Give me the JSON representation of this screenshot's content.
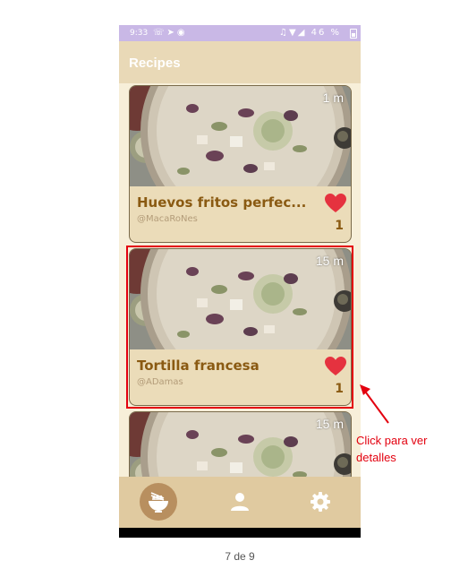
{
  "statusbar": {
    "time": "9:33",
    "left_icons": [
      "whatsapp-icon",
      "telegram-icon",
      "app-icon"
    ],
    "right_icons": [
      "mute-icon",
      "wifi-icon",
      "signal-icon"
    ],
    "battery": "46 %"
  },
  "appbar": {
    "title": "Recipes"
  },
  "recipes": [
    {
      "duration": "1 m",
      "name": "Huevos fritos perfec...",
      "author": "@MacaRoNes",
      "likes": "1",
      "liked": true
    },
    {
      "duration": "15 m",
      "name": "Tortilla francesa",
      "author": "@ADamas",
      "likes": "1",
      "liked": true
    },
    {
      "duration": "15 m",
      "name": "",
      "author": "",
      "likes": "",
      "liked": true
    }
  ],
  "bottom_nav": [
    {
      "icon": "noodle-bowl-icon",
      "active": true
    },
    {
      "icon": "person-icon",
      "active": false
    },
    {
      "icon": "gear-icon",
      "active": false
    }
  ],
  "annotation": {
    "text": "Click para ver detalles"
  },
  "pager": {
    "text": "7 de 9"
  },
  "colors": {
    "status_bar": "#c9b8e6",
    "app_bar": "#e9d9b7",
    "background": "#f7efd9",
    "card": "#ebdcb9",
    "title_text": "#8a5a12",
    "heart": "#e5323f",
    "bottom_bar": "#e0caa0",
    "highlight": "#e3000f"
  }
}
